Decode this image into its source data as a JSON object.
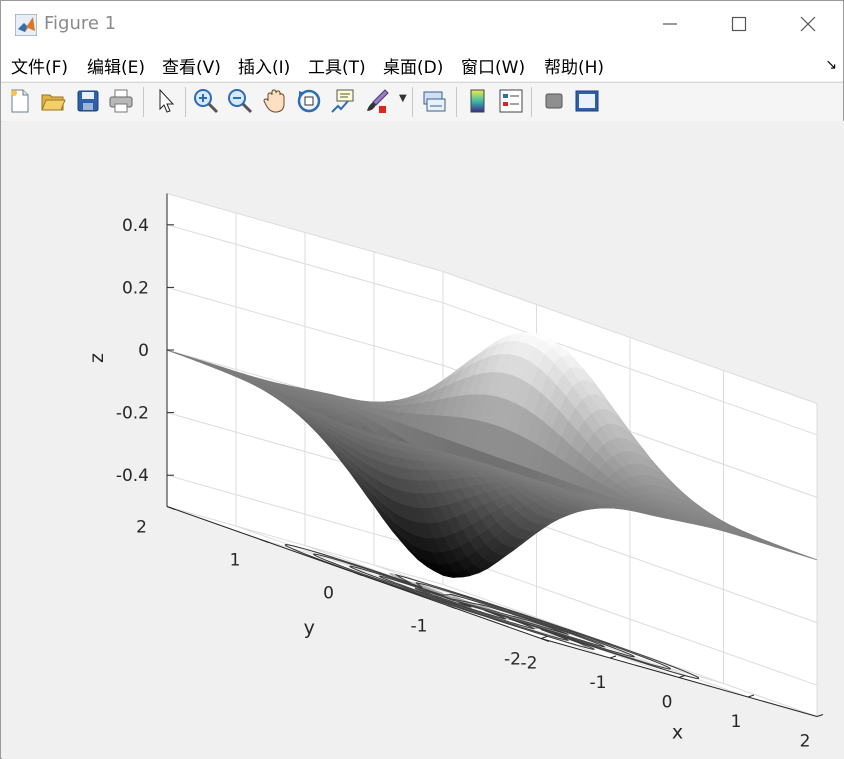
{
  "window": {
    "title": "Figure 1"
  },
  "menu": {
    "items": [
      "文件(F)",
      "编辑(E)",
      "查看(V)",
      "插入(I)",
      "工具(T)",
      "桌面(D)",
      "窗口(W)",
      "帮助(H)"
    ]
  },
  "toolbar": {
    "icons": [
      "new-figure-icon",
      "open-file-icon",
      "save-icon",
      "print-icon",
      "select-pointer-icon",
      "zoom-in-icon",
      "zoom-out-icon",
      "pan-hand-icon",
      "rotate-3d-icon",
      "data-cursor-icon",
      "brush-icon",
      "link-plot-icon",
      "insert-colorbar-icon",
      "insert-legend-icon",
      "hide-plot-tools-icon",
      "show-plot-tools-icon"
    ]
  },
  "chart_data": {
    "type": "surface",
    "function": "z = x*exp(-x^2 - y^2)",
    "colormap": "gray",
    "contour_on_floor": true,
    "xlabel": "x",
    "ylabel": "y",
    "zlabel": "z",
    "xlim": [
      -2,
      2
    ],
    "ylim": [
      -2,
      2
    ],
    "zlim": [
      -0.5,
      0.5
    ],
    "x_ticks": [
      "-2",
      "-1",
      "0",
      "1",
      "2"
    ],
    "y_ticks": [
      "-2",
      "-1",
      "0",
      "1",
      "2"
    ],
    "z_ticks": [
      "-0.4",
      "-0.2",
      "0",
      "0.2",
      "0.4"
    ],
    "z_tick_values": [
      -0.4,
      -0.2,
      0,
      0.2,
      0.4
    ],
    "grid": true,
    "view": "3d-default"
  }
}
